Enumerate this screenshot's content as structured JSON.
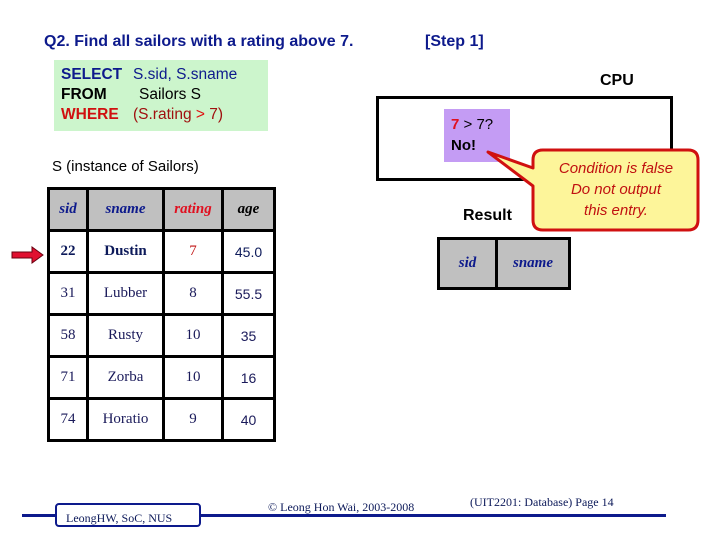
{
  "slide": {
    "title": "Q2. Find all sailors with a rating above 7.",
    "step": "[Step 1]"
  },
  "sql": {
    "select_kw": "SELECT",
    "select_val": "S.sid, S.sname",
    "from_kw": "FROM",
    "from_val": "Sailors S",
    "where_kw": "WHERE",
    "where_open": "(S.rating ",
    "where_op": ">",
    "where_close": " 7)"
  },
  "cpu": {
    "label": "CPU",
    "cond_value": "7",
    "cond_rest": " > 7?",
    "cond_answer": "No!"
  },
  "callout": {
    "lines": [
      "Condition is false",
      "Do not output",
      "this entry."
    ],
    "fill": "#fdf59a",
    "stroke": "#d01010"
  },
  "sailors": {
    "label": "S (instance of Sailors)",
    "columns": [
      "sid",
      "sname",
      "rating",
      "age"
    ],
    "current_row_index": 0,
    "rows": [
      [
        "22",
        "Dustin",
        "7",
        "45.0"
      ],
      [
        "31",
        "Lubber",
        "8",
        "55.5"
      ],
      [
        "58",
        "Rusty",
        "10",
        "35"
      ],
      [
        "71",
        "Zorba",
        "10",
        "16"
      ],
      [
        "74",
        "Horatio",
        "9",
        "40"
      ]
    ]
  },
  "result": {
    "label": "Result",
    "columns": [
      "sid",
      "sname"
    ]
  },
  "footer": {
    "author_box": "LeongHW, SoC, NUS",
    "copyright": "© Leong Hon Wai, 2003-2008",
    "page": "(UIT2201: Database) Page 14"
  },
  "colors": {
    "accent_navy": "#0d1a8c",
    "highlight_red": "#e01020",
    "sql_bg": "#ccf5cc",
    "cond_bg": "#c49cf4",
    "header_gray": "#c0c0c0"
  }
}
